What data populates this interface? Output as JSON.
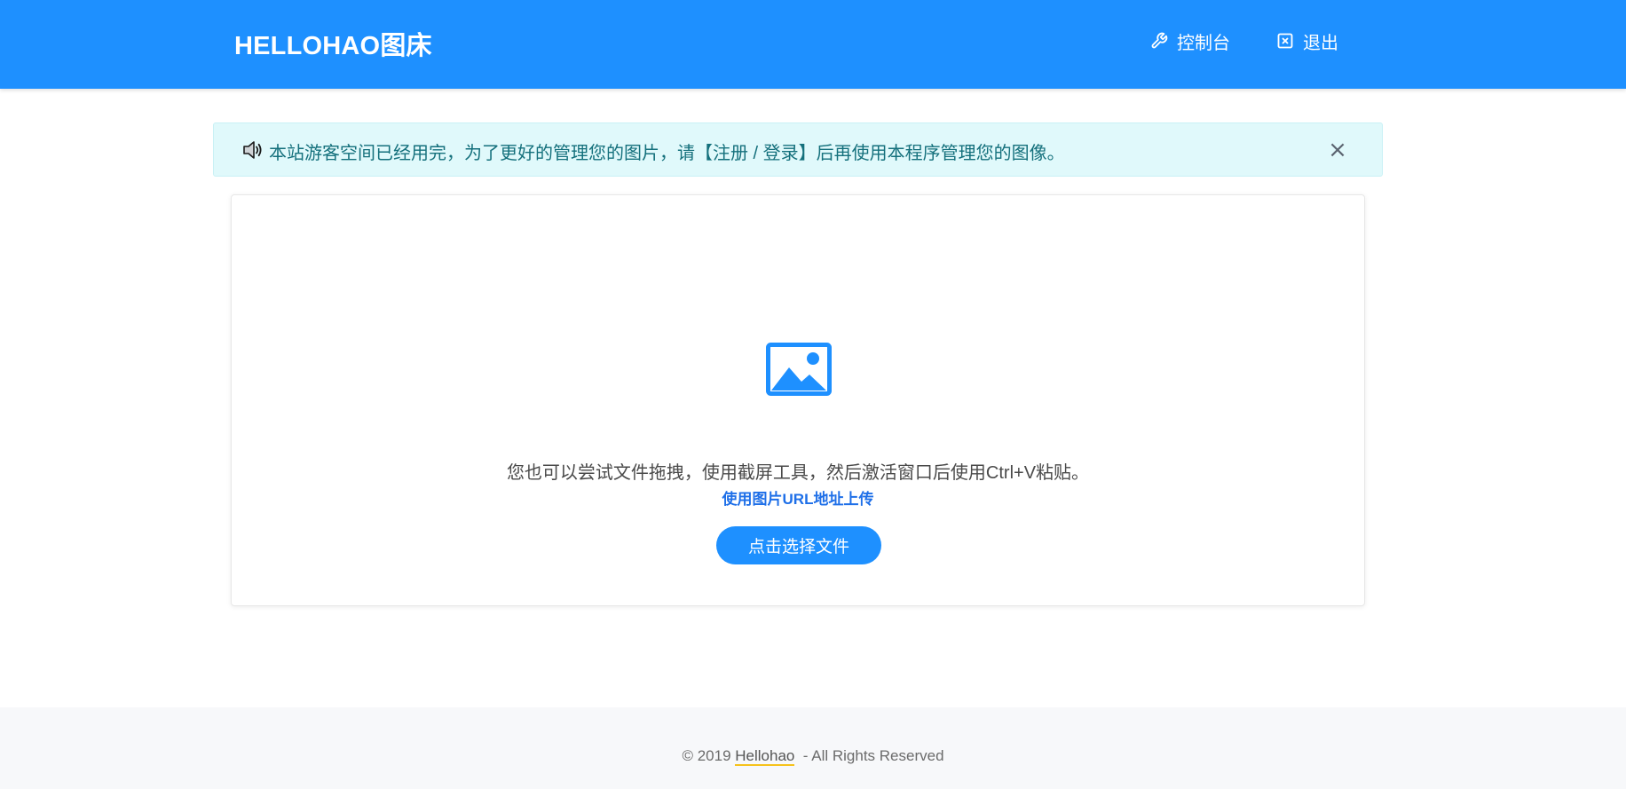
{
  "header": {
    "brand": "HELLOHAO图床",
    "nav": {
      "console_label": "控制台",
      "console_icon": "wrench-icon",
      "logout_label": "退出",
      "logout_icon": "close-square-icon"
    }
  },
  "alert": {
    "icon": "speaker-icon",
    "text": "本站游客空间已经用完，为了更好的管理您的图片，请【注册 / 登录】后再使用本程序管理您的图像。",
    "close_symbol": "×"
  },
  "upload": {
    "icon": "image-icon",
    "hint": "您也可以尝试文件拖拽，使用截屏工具，然后激活窗口后使用Ctrl+V粘贴。",
    "url_link": "使用图片URL地址上传",
    "button_label": "点击选择文件"
  },
  "footer": {
    "prefix": "© 2019 ",
    "link": "Hellohao",
    "suffix": "  - All Rights Reserved"
  },
  "colors": {
    "primary": "#1e90ff",
    "alert_bg": "#e0f9fb",
    "alert_text": "#14707c",
    "link": "#1e6fe8",
    "footer_underline": "#f6c21b"
  }
}
